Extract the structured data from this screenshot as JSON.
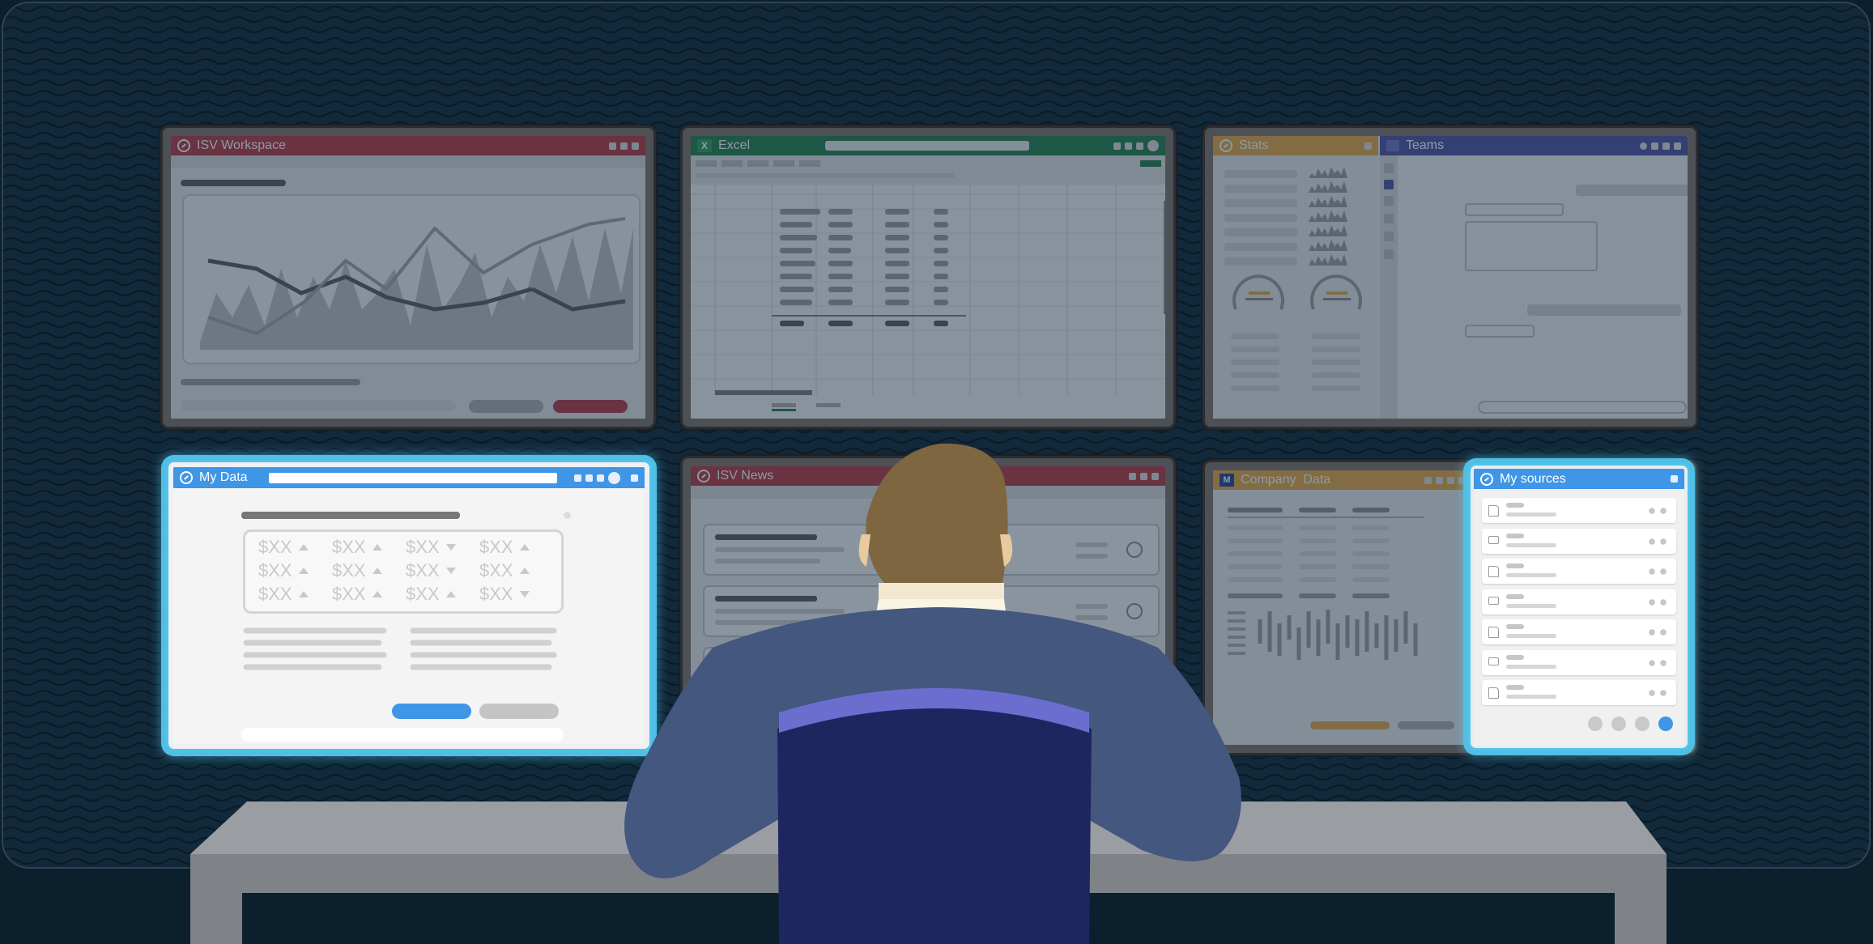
{
  "monitors": {
    "isv_workspace": {
      "title": "ISV Workspace",
      "accent": "#b8313d"
    },
    "excel": {
      "title": "Excel",
      "icon": "X",
      "accent": "#1f7a43"
    },
    "stats": {
      "title": "Stats",
      "accent": "#e9a440"
    },
    "teams": {
      "title": "Teams",
      "accent": "#4a4d9f"
    },
    "my_data": {
      "title": "My Data",
      "accent": "#3f95e6",
      "grid": [
        [
          {
            "v": "$XX",
            "t": "up"
          },
          {
            "v": "$XX",
            "t": "up"
          },
          {
            "v": "$XX",
            "t": "down"
          },
          {
            "v": "$XX",
            "t": "up"
          }
        ],
        [
          {
            "v": "$XX",
            "t": "up"
          },
          {
            "v": "$XX",
            "t": "up"
          },
          {
            "v": "$XX",
            "t": "down"
          },
          {
            "v": "$XX",
            "t": "up"
          }
        ],
        [
          {
            "v": "$XX",
            "t": "up"
          },
          {
            "v": "$XX",
            "t": "up"
          },
          {
            "v": "$XX",
            "t": "up"
          },
          {
            "v": "$XX",
            "t": "down"
          }
        ]
      ]
    },
    "isv_news": {
      "title": "ISV News",
      "accent": "#b8313d"
    },
    "company_data": {
      "title": "Company  Data",
      "icon": "M",
      "accent": "#e9a440"
    },
    "my_sources": {
      "title": "My sources",
      "accent": "#3f95e6",
      "items": [
        "file-icon",
        "folder-icon",
        "contact-card-icon",
        "folder-icon",
        "document-icon",
        "folder-icon",
        "file-icon"
      ],
      "pages": 4,
      "active_page": 4
    }
  },
  "colors": {
    "background": "#0b1f2c",
    "highlight": "#52c3ea",
    "desk": "#8f9297",
    "jacket": "#3c5078",
    "chair": "#1e2660",
    "hair": "#7d6640"
  }
}
